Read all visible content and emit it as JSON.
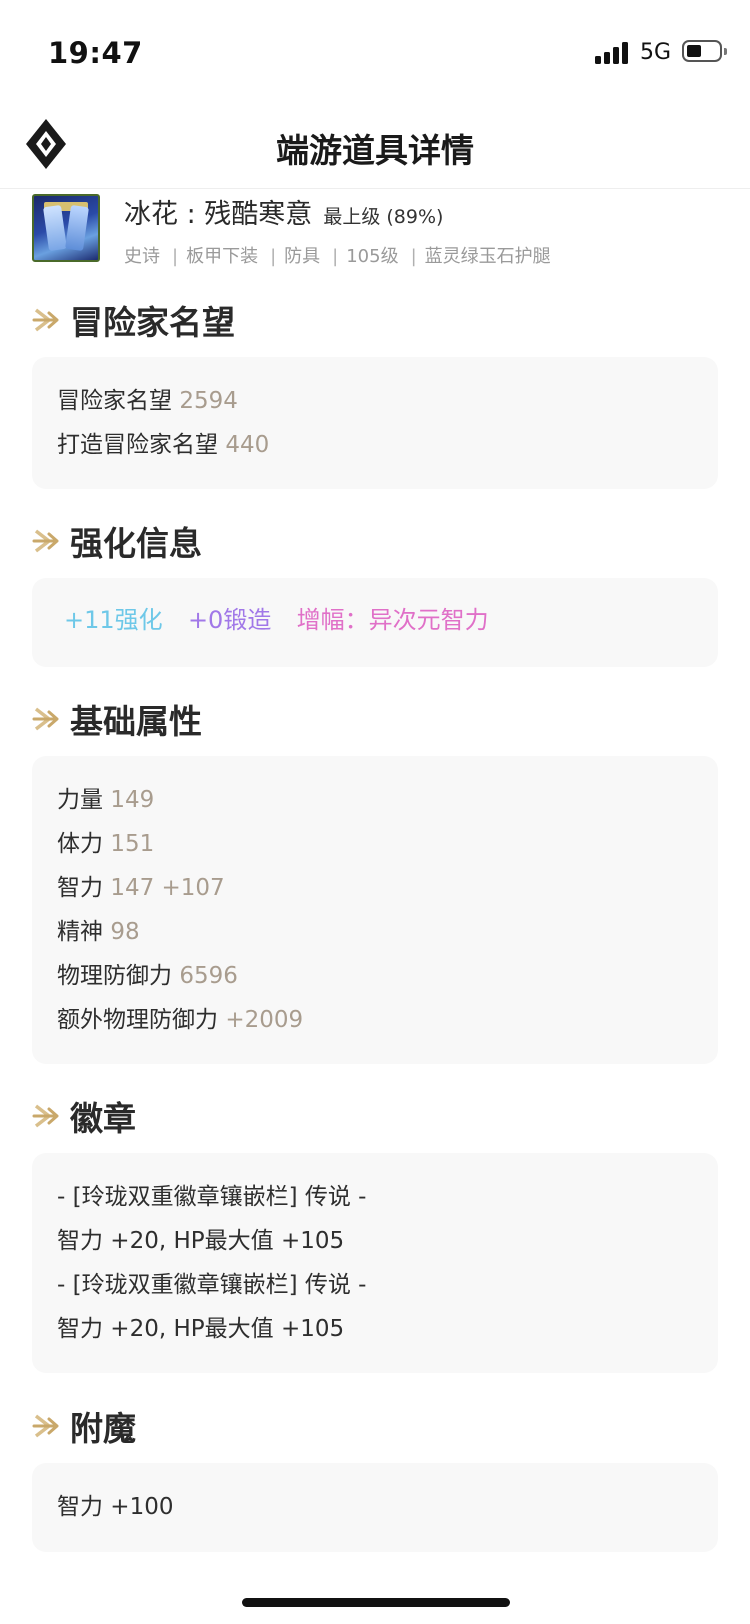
{
  "status_bar": {
    "time": "19:47",
    "network": "5G",
    "battery_level": 0.4
  },
  "nav": {
    "title": "端游道具详情",
    "logo_icon": "diamond-logo-icon"
  },
  "item": {
    "name": "冰花 : 残酷寒意",
    "grade": "最上级 (89%)",
    "tags": [
      "史诗",
      "板甲下装",
      "防具",
      "105级",
      "蓝灵绿玉石护腿"
    ]
  },
  "sections": {
    "fame": {
      "title": "冒险家名望",
      "lines": [
        {
          "label": "冒险家名望",
          "value": "2594"
        },
        {
          "label": "打造冒险家名望",
          "value": "440"
        }
      ]
    },
    "enhance": {
      "title": "强化信息",
      "reinforce": "+11强化",
      "forge": "+0锻造",
      "amplify": "增幅：异次元智力",
      "colors": {
        "reinforce": "#6ec8e8",
        "forge": "#a178e8",
        "amplify": "#e070c8"
      }
    },
    "base": {
      "title": "基础属性",
      "lines": [
        {
          "label": "力量",
          "value": "149"
        },
        {
          "label": "体力",
          "value": "151"
        },
        {
          "label": "智力",
          "value": "147 +107"
        },
        {
          "label": "精神",
          "value": "98"
        },
        {
          "label": "物理防御力",
          "value": "6596"
        },
        {
          "label": "额外物理防御力",
          "value": "+2009"
        }
      ]
    },
    "emblem": {
      "title": "徽章",
      "lines": [
        "- [玲珑双重徽章镶嵌栏] 传说 -",
        "智力 +20, HP最大值 +105",
        "- [玲珑双重徽章镶嵌栏] 传说 -",
        "智力 +20, HP最大值 +105"
      ]
    },
    "enchant": {
      "title": "附魔",
      "lines": [
        "智力 +100"
      ]
    }
  },
  "colors": {
    "accent_arrow": "#c9a86a",
    "value_text": "#a89c8e",
    "card_bg": "#f8f8f8"
  }
}
